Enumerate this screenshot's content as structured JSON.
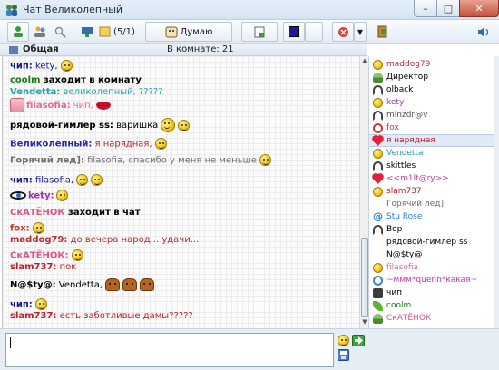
{
  "window": {
    "title": "Чат Великолепный"
  },
  "toolbar": {
    "privates_count": "(5/1)",
    "thinking_label": "Думаю"
  },
  "room": {
    "name": "Общая",
    "count_label": "В комнате: 21"
  },
  "colors": {
    "selected_row": "#dfeaf6",
    "accent": "#2a6ab8"
  },
  "messages": [
    {
      "nick": "чип:",
      "nick_color": "#1a1a8c",
      "text": " kety,",
      "text_color": "#1a1a8c",
      "emote": "smile"
    },
    {
      "nick": "coolm",
      "nick_color": "#1a7a1a",
      "text": " заходит в комнату",
      "text_color": "#000000",
      "bold_text": true
    },
    {
      "nick": "Vendetta:",
      "nick_color": "#1fa3b0",
      "text": " великолепный, ?????",
      "text_color": "#1fa3b0"
    },
    {
      "nick": "filasofia:",
      "nick_color": "#e06b9a",
      "text": " чип,",
      "text_color": "#e06b9a",
      "avatar": true,
      "emote": "lips"
    },
    {
      "nick": "рядовой-гимлер ss:",
      "nick_color": "#000000",
      "text": " варишка",
      "text_color": "#000000",
      "emote": "smile2"
    },
    {
      "nick": "Великолепный:",
      "nick_color": "#2a2aa8",
      "text": " я нарядная,",
      "text_color": "#b81f2a",
      "emote": "smile"
    },
    {
      "nick": "Горячий лед]:",
      "nick_color": "#6e6e6e",
      "text": " filasofia, спасибо у меня не меньше",
      "text_color": "#6e6e6e",
      "emote": "smile"
    },
    {
      "nick": "чип:",
      "nick_color": "#1a1a8c",
      "text": " filasofia,",
      "text_color": "#1a1a8c",
      "emote": "bears"
    },
    {
      "nick": "kety:",
      "nick_color": "#9a2fb0",
      "text": "",
      "text_color": "#9a2fb0",
      "eye": true,
      "emote": "smile"
    },
    {
      "nick": "СкАТЁНОК",
      "nick_color": "#e0548a",
      "text": " заходит в чат",
      "text_color": "#000000",
      "bold_text": true
    },
    {
      "nick": "fox:",
      "nick_color": "#c0392b",
      "text": "",
      "text_color": "#c0392b",
      "emote": "smile"
    },
    {
      "nick": "maddog79:",
      "nick_color": "#b03030",
      "text": " до вечера народ... удачи...",
      "text_color": "#b03030"
    },
    {
      "nick": "СкАТЁНОК:",
      "nick_color": "#e0548a",
      "text": "",
      "text_color": "#e0548a",
      "emote": "smile"
    },
    {
      "nick": "slam737:",
      "nick_color": "#b81f2a",
      "text": " пок",
      "text_color": "#b81f2a"
    },
    {
      "nick": "N@$ty@:",
      "nick_color": "#000000",
      "text": " Vendetta,",
      "text_color": "#000000",
      "emote": "bears3"
    },
    {
      "nick": "чип:",
      "nick_color": "#1a1a8c",
      "text": "",
      "text_color": "#1a1a8c",
      "emote": "smile"
    },
    {
      "nick": "slam737:",
      "nick_color": "#b81f2a",
      "text": " есть заботливые дамы?????",
      "text_color": "#b81f2a"
    }
  ],
  "users": [
    {
      "name": "maddog79",
      "color": "#b03030",
      "icon": "smile"
    },
    {
      "name": "Директор",
      "color": "#000000",
      "icon": "person"
    },
    {
      "name": "olback",
      "color": "#000000",
      "icon": "headset"
    },
    {
      "name": "kety",
      "color": "#9a2fb0",
      "icon": "smile"
    },
    {
      "name": "minzdr@v",
      "color": "#555555",
      "icon": "headset"
    },
    {
      "name": "fox",
      "color": "#c0392b",
      "icon": "red"
    },
    {
      "name": "я нарядная",
      "color": "#b81f2a",
      "icon": "heart",
      "selected": true
    },
    {
      "name": "Vendetta",
      "color": "#1fa3b0",
      "icon": "smile"
    },
    {
      "name": "skittles",
      "color": "#000000",
      "icon": "headset"
    },
    {
      "name": "<<m1lt@ry>>",
      "color": "#c43ab0",
      "icon": "heart"
    },
    {
      "name": "slam737",
      "color": "#b81f2a",
      "icon": "smile"
    },
    {
      "name": "Горячий лед]",
      "color": "#6e6e6e",
      "icon": "none"
    },
    {
      "name": "Stu Rose",
      "color": "#2a7bd1",
      "icon": "at"
    },
    {
      "name": "Bop",
      "color": "#000000",
      "icon": "headset"
    },
    {
      "name": "рядовой-гимлер ss",
      "color": "#000000",
      "icon": "none"
    },
    {
      "name": "N@$ty@",
      "color": "#000000",
      "icon": "none"
    },
    {
      "name": "filasofia",
      "color": "#e06b9a",
      "icon": "smile"
    },
    {
      "name": "~ммм*quenn*какая~",
      "color": "#c43ab0",
      "icon": "ring"
    },
    {
      "name": "чип",
      "color": "#000000",
      "icon": "chat"
    },
    {
      "name": "coolm",
      "color": "#1a7a1a",
      "icon": "leaf"
    },
    {
      "name": "СкАТЁНОК",
      "color": "#e0548a",
      "icon": "person"
    }
  ]
}
